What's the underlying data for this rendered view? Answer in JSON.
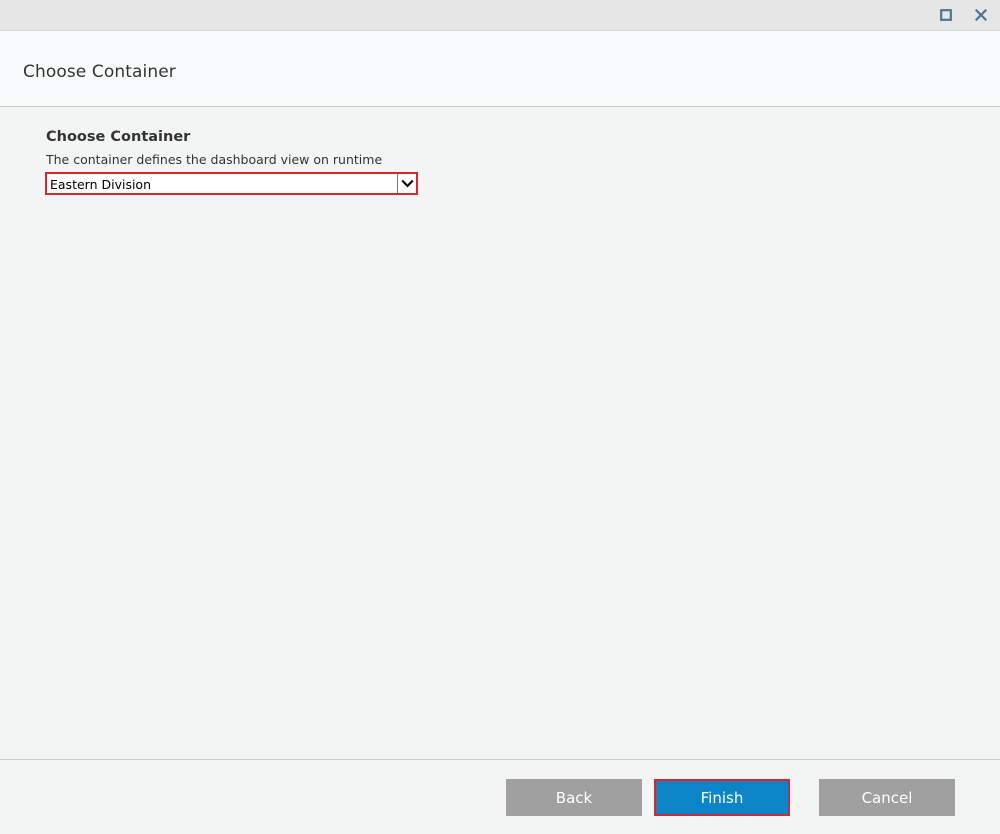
{
  "window": {
    "controls": {
      "maximize_icon": "maximize-icon",
      "close_icon": "close-icon"
    }
  },
  "header": {
    "title": "Choose Container"
  },
  "main": {
    "section_heading": "Choose Container",
    "section_description": "The container defines the dashboard view on runtime",
    "container_select": {
      "selected_value": "Eastern Division",
      "arrow_icon": "chevron-down-icon"
    }
  },
  "footer": {
    "back_label": "Back",
    "finish_label": "Finish",
    "cancel_label": "Cancel"
  },
  "colors": {
    "accent": "#0b85c8",
    "highlight_border": "#d9262b",
    "disabled_button": "#a0a0a0",
    "icon_color": "#4a7593"
  }
}
